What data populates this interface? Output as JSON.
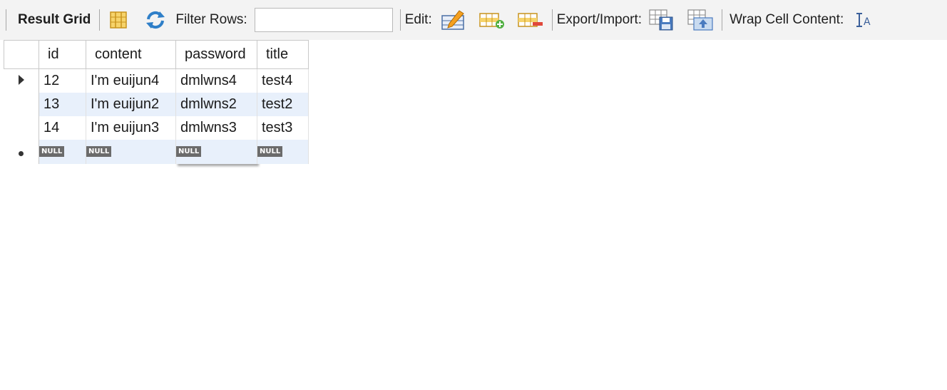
{
  "toolbar": {
    "result_grid_label": "Result Grid",
    "filter_label": "Filter Rows:",
    "filter_value": "",
    "edit_label": "Edit:",
    "export_label": "Export/Import:",
    "wrap_label": "Wrap Cell Content:",
    "icons": [
      "grid-layout-icon",
      "refresh-icon",
      "edit-pencil-icon",
      "add-row-icon",
      "delete-row-icon",
      "export-save-icon",
      "import-icon",
      "wrap-text-icon"
    ]
  },
  "grid": {
    "columns": [
      "id",
      "content",
      "password",
      "title"
    ],
    "rows": [
      [
        "12",
        "I'm euijun4",
        "dmlwns4",
        "test4"
      ],
      [
        "13",
        "I'm euijun2",
        "dmlwns2",
        "test2"
      ],
      [
        "14",
        "I'm euijun3",
        "dmlwns3",
        "test3"
      ]
    ],
    "null_label": "NULL"
  },
  "colors": {
    "toolbar_bg": "#f3f3f3",
    "alt_row": "#e8f0fb",
    "null_badge": "#6b6b6b"
  }
}
